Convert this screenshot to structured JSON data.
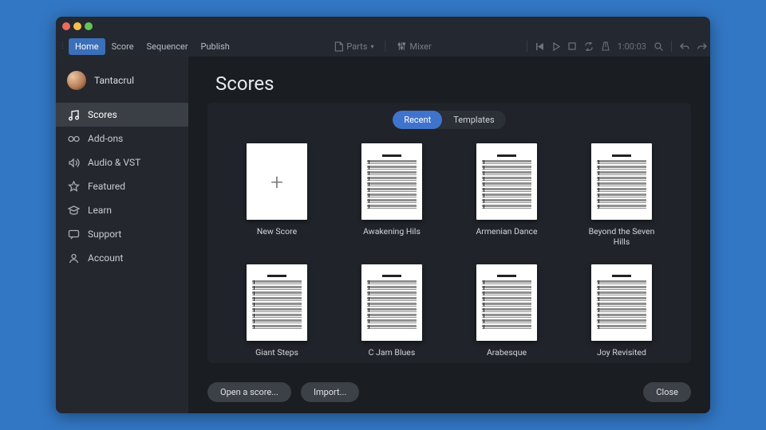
{
  "menubar": {
    "items": [
      "Home",
      "Score",
      "Sequencer",
      "Publish"
    ],
    "center": {
      "parts": "Parts",
      "mixer": "Mixer"
    },
    "time": "1:00:03"
  },
  "user": {
    "name": "Tantacrul"
  },
  "sidebar": {
    "items": [
      {
        "label": "Scores",
        "icon": "music"
      },
      {
        "label": "Add-ons",
        "icon": "addons"
      },
      {
        "label": "Audio & VST",
        "icon": "audio"
      },
      {
        "label": "Featured",
        "icon": "star"
      },
      {
        "label": "Learn",
        "icon": "learn"
      },
      {
        "label": "Support",
        "icon": "support"
      },
      {
        "label": "Account",
        "icon": "account"
      }
    ],
    "active": 0
  },
  "page": {
    "title": "Scores"
  },
  "tabs": {
    "recent": "Recent",
    "templates": "Templates",
    "active": "recent"
  },
  "scores": [
    {
      "label": "New Score",
      "new": true
    },
    {
      "label": "Awakening Hils"
    },
    {
      "label": "Armenian Dance"
    },
    {
      "label": "Beyond the Seven Hills"
    },
    {
      "label": "Giant Steps"
    },
    {
      "label": "C Jam Blues"
    },
    {
      "label": "Arabesque"
    },
    {
      "label": "Joy Revisited"
    }
  ],
  "footer": {
    "open": "Open a score...",
    "import": "Import...",
    "close": "Close"
  }
}
